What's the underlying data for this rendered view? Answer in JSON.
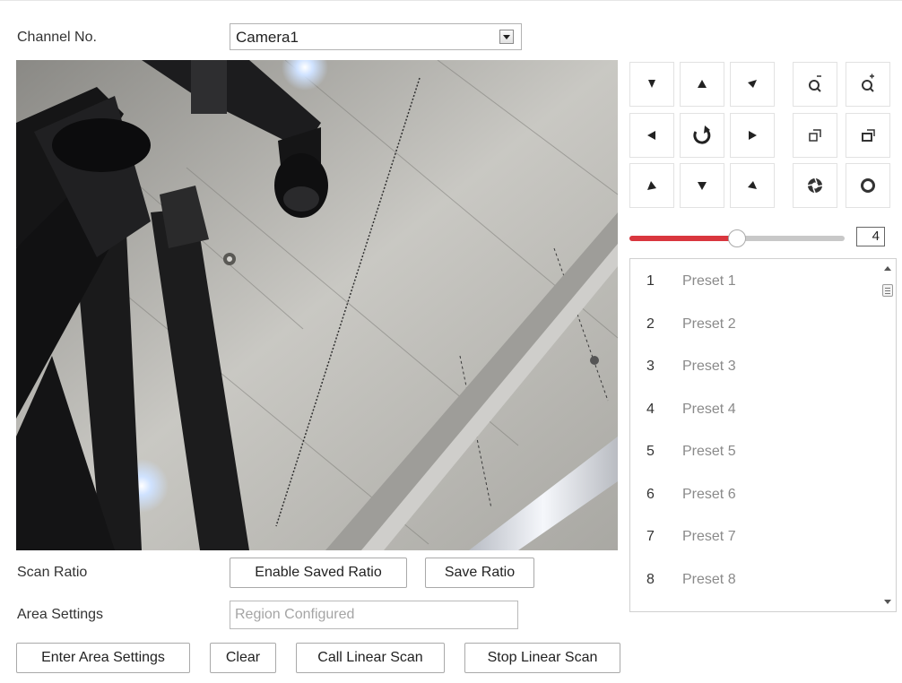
{
  "channel": {
    "label": "Channel No.",
    "selected": "Camera1"
  },
  "ptz": {
    "buttons": [
      {
        "name": "pan-up-left-button",
        "icon": "arrow-up-left-icon"
      },
      {
        "name": "pan-up-button",
        "icon": "arrow-up-icon"
      },
      {
        "name": "pan-up-right-button",
        "icon": "arrow-up-right-icon"
      },
      {
        "name": "pan-left-button",
        "icon": "arrow-left-icon"
      },
      {
        "name": "auto-pan-button",
        "icon": "rotate-icon"
      },
      {
        "name": "pan-right-button",
        "icon": "arrow-right-icon"
      },
      {
        "name": "pan-down-left-button",
        "icon": "arrow-down-left-icon"
      },
      {
        "name": "pan-down-button",
        "icon": "arrow-down-icon"
      },
      {
        "name": "pan-down-right-button",
        "icon": "arrow-down-right-icon"
      },
      {
        "name": "zoom-out-button",
        "icon": "zoom-out-icon"
      },
      {
        "name": "zoom-in-button",
        "icon": "zoom-in-icon"
      },
      {
        "name": "focus-near-button",
        "icon": "focus-near-icon"
      },
      {
        "name": "focus-far-button",
        "icon": "focus-far-icon"
      },
      {
        "name": "iris-close-button",
        "icon": "iris-close-icon"
      },
      {
        "name": "iris-open-button",
        "icon": "iris-open-icon"
      }
    ],
    "speed": {
      "value": "4",
      "fraction": 0.5,
      "accent": "#d9363e"
    }
  },
  "presets": [
    {
      "num": "1",
      "name": "Preset 1"
    },
    {
      "num": "2",
      "name": "Preset 2"
    },
    {
      "num": "3",
      "name": "Preset 3"
    },
    {
      "num": "4",
      "name": "Preset 4"
    },
    {
      "num": "5",
      "name": "Preset 5"
    },
    {
      "num": "6",
      "name": "Preset 6"
    },
    {
      "num": "7",
      "name": "Preset 7"
    },
    {
      "num": "8",
      "name": "Preset 8"
    }
  ],
  "scan_ratio": {
    "label": "Scan Ratio",
    "enable_label": "Enable Saved Ratio",
    "save_label": "Save Ratio"
  },
  "area": {
    "label": "Area Settings",
    "placeholder": "Region Configured"
  },
  "actions": {
    "enter_area": "Enter Area Settings",
    "clear": "Clear",
    "call_linear": "Call Linear Scan",
    "stop_linear": "Stop Linear Scan"
  }
}
